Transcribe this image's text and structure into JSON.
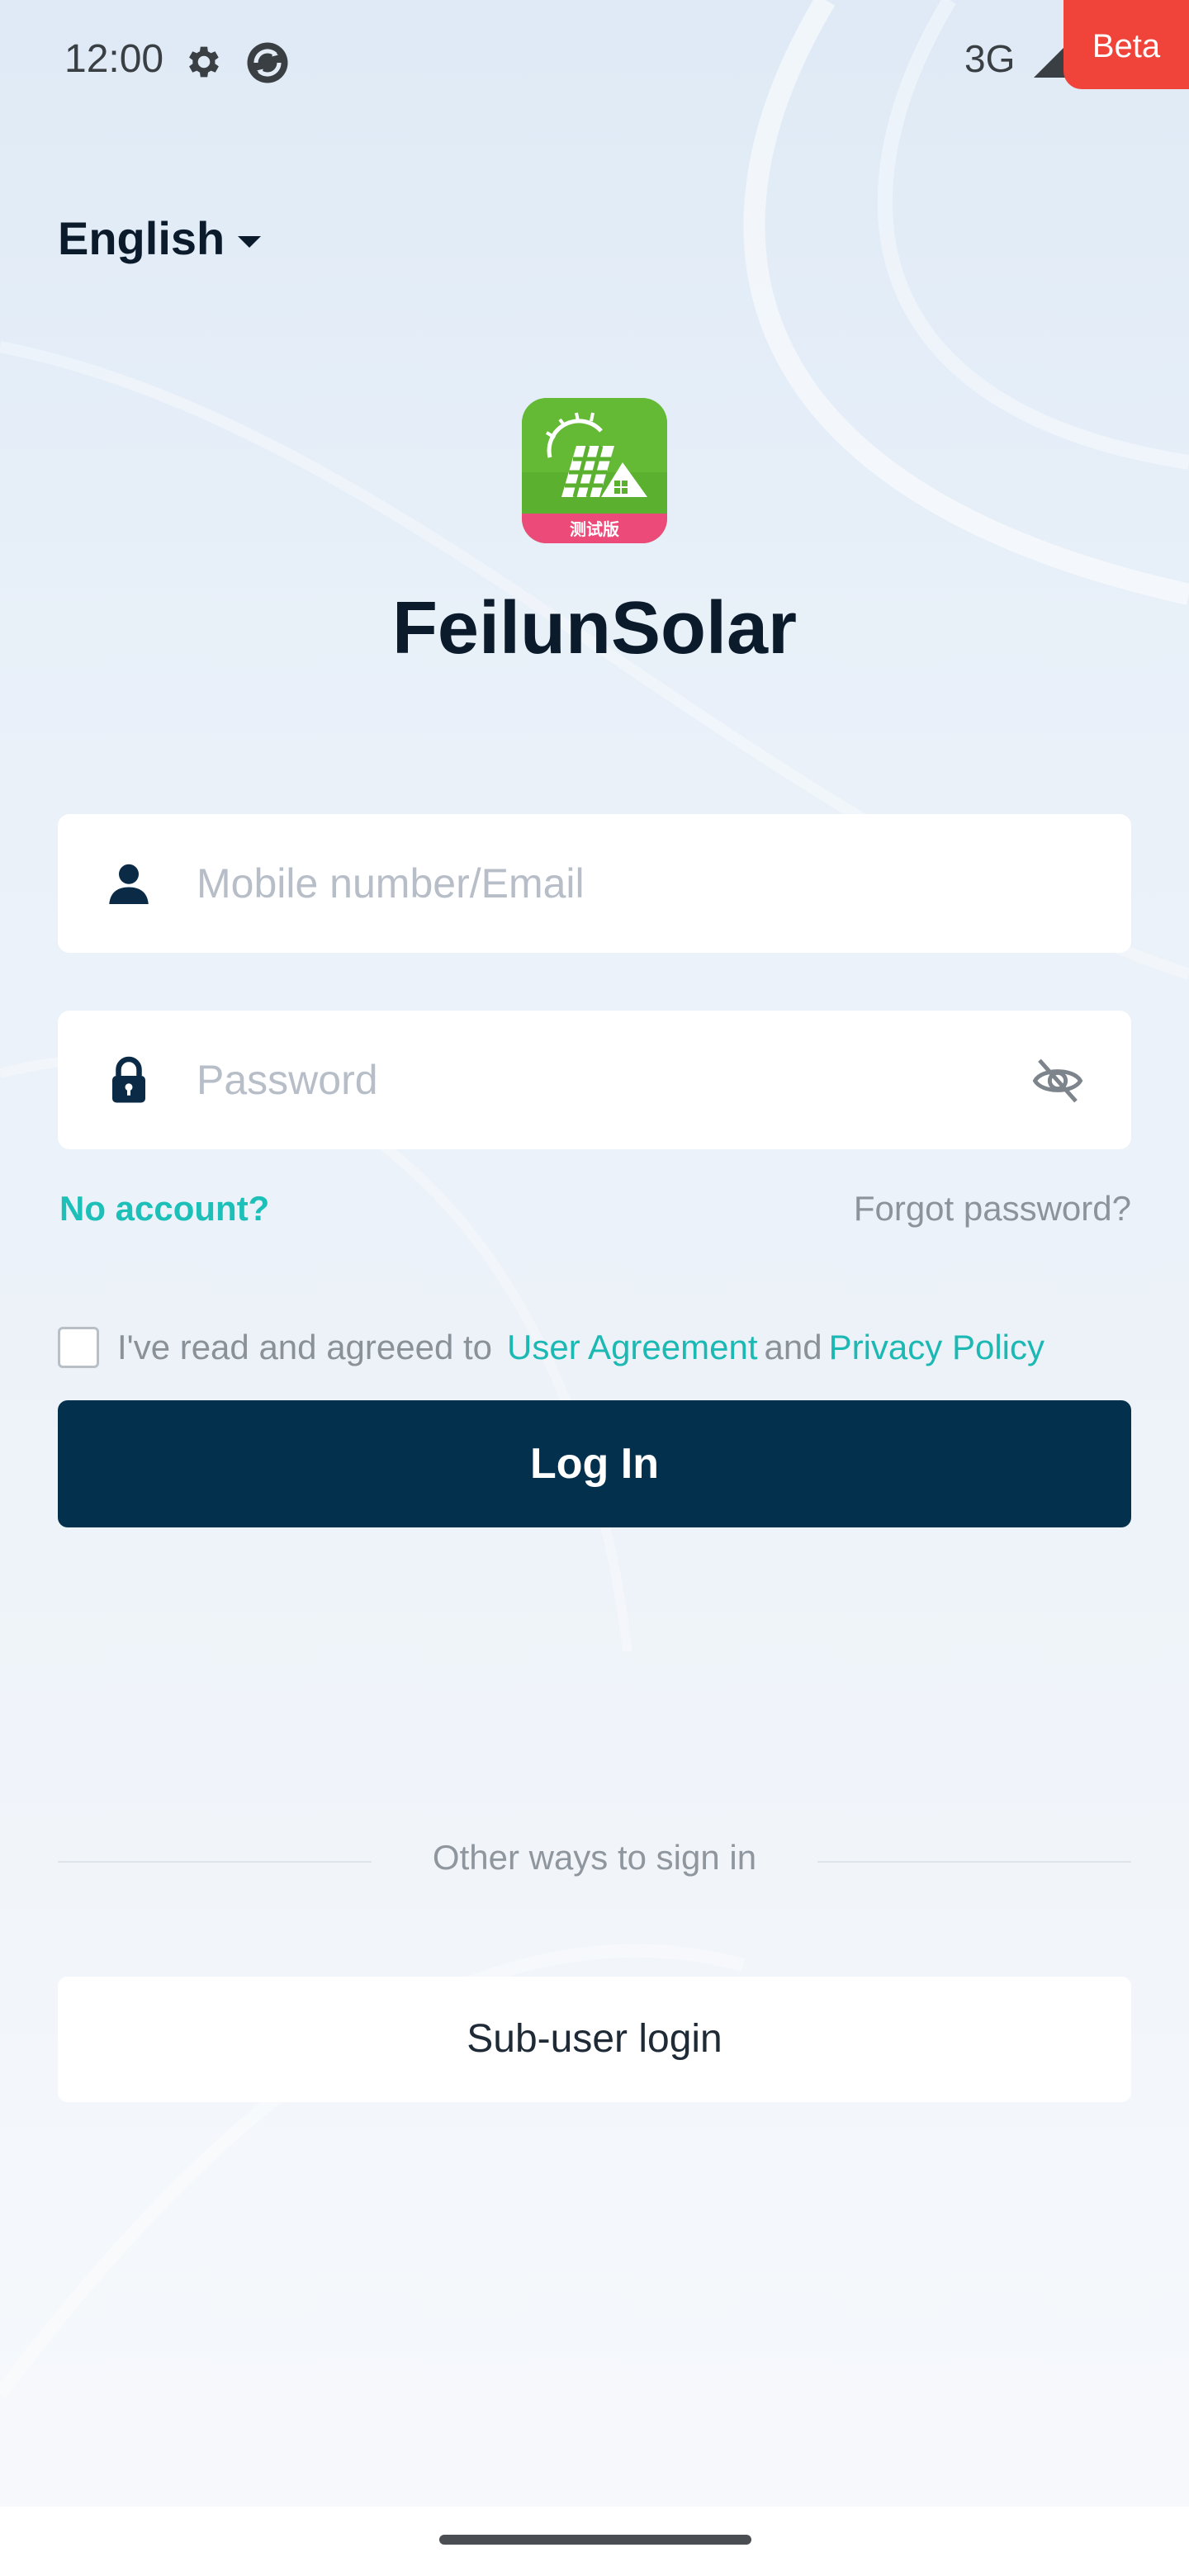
{
  "status_bar": {
    "time": "12:00",
    "network": "3G",
    "icons": [
      "gear-icon",
      "sync-icon",
      "signal-icon",
      "battery-icon"
    ]
  },
  "beta_badge": "Beta",
  "language": {
    "selected": "English"
  },
  "app": {
    "title": "FeilunSolar",
    "logo_badge_text": "测试版",
    "logo_colors": {
      "green": "#5cb030",
      "pink": "#ec4a78"
    }
  },
  "login_form": {
    "username_placeholder": "Mobile number/Email",
    "password_placeholder": "Password",
    "no_account": "No account?",
    "forgot_password": "Forgot password?",
    "agreement_prefix": "I've read and agreeed to",
    "user_agreement": "User Agreement",
    "and_text": "and",
    "privacy_policy": "Privacy Policy",
    "login_button": "Log In"
  },
  "other_signin": {
    "label": "Other ways to sign in",
    "subuser_button": "Sub-user login"
  },
  "colors": {
    "accent": "#1cc0b8",
    "primary_button": "#03304d",
    "beta": "#f0443a",
    "forgot_text": "#8c939b"
  }
}
